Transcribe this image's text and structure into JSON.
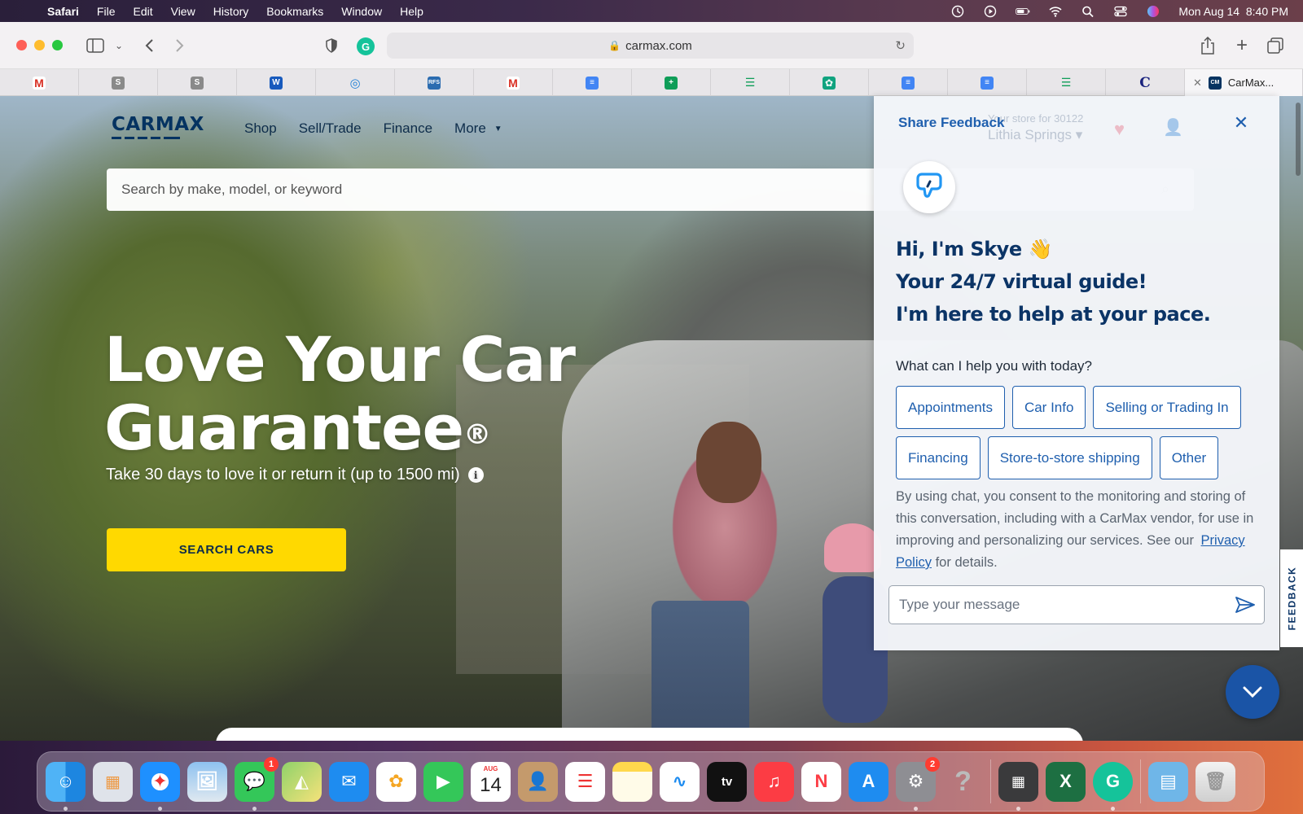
{
  "menubar": {
    "app_name": "Safari",
    "menus": [
      "File",
      "Edit",
      "View",
      "History",
      "Bookmarks",
      "Window",
      "Help"
    ],
    "datetime": "Mon Aug 14  8:40 PM"
  },
  "browser": {
    "url": "carmax.com",
    "active_tab_title": "CarMax..."
  },
  "site": {
    "logo_text": "CARMAX",
    "nav": [
      "Shop",
      "Sell/Trade",
      "Finance",
      "More"
    ],
    "search_placeholder": "Search by make, model, or keyword",
    "store_label": "Your store for 30122",
    "store_city": "Lithia Springs",
    "hero_title_line1": "Love Your Car",
    "hero_title_line2": "Guarantee",
    "hero_title_mark": "®",
    "hero_subtitle": "Take 30 days to love it or return it (up to 1500 mi)",
    "cta_label": "SEARCH CARS"
  },
  "chat": {
    "share_feedback": "Share Feedback",
    "greeting_line1": "Hi, I'm Skye 👋",
    "greeting_line2": "Your 24/7 virtual guide!",
    "greeting_line3": "I'm here to help at your pace.",
    "question": "What can I help you with today?",
    "options": [
      "Appointments",
      "Car Info",
      "Selling or Trading In",
      "Financing",
      "Store-to-store shipping",
      "Other"
    ],
    "consent_text": "By using chat, you consent to the monitoring and storing of this conversation, including with a CarMax vendor, for use in improving and personalizing our services. See our",
    "privacy_link": "Privacy Policy",
    "consent_tail": " for details.",
    "input_placeholder": "Type your message"
  },
  "feedback_tab": "FEEDBACK",
  "dock": {
    "calendar_month": "AUG",
    "calendar_day": "14",
    "messages_badge": "1",
    "settings_badge": "2"
  },
  "colors": {
    "carmax_navy": "#053361",
    "chat_blue": "#1f5fae",
    "cta_yellow": "#ffd900",
    "fab_blue": "#1a54a6"
  }
}
